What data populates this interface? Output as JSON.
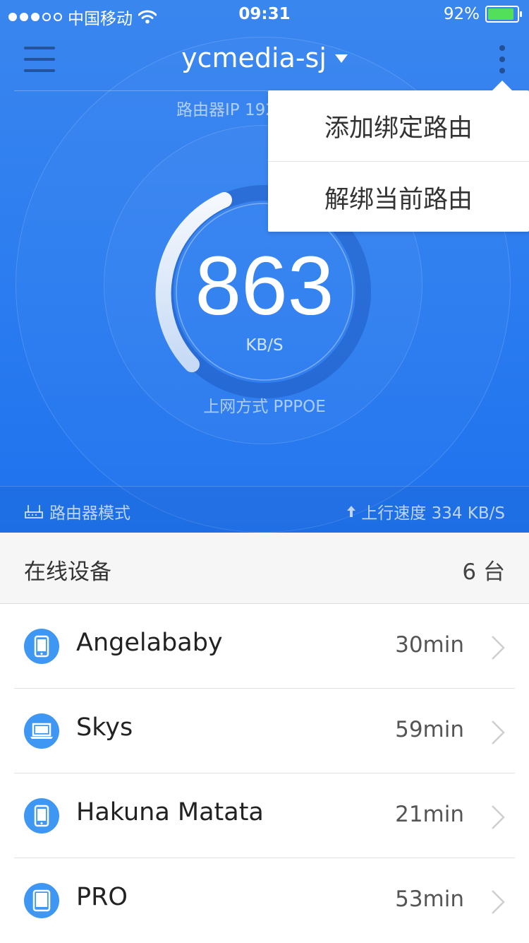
{
  "status_bar": {
    "carrier": "中国移动",
    "time": "09:31",
    "battery": "92%",
    "battery_level": 0.92
  },
  "nav": {
    "title": "ycmedia-sj"
  },
  "router": {
    "ip_label": "路由器IP 192",
    "speed_value": "863",
    "speed_unit": "KB/S",
    "connection_type": "上网方式 PPPOE",
    "mode": "路由器模式",
    "upload_speed": "上行速度 334 KB/S"
  },
  "dropdown": {
    "items": [
      {
        "label": "添加绑定路由"
      },
      {
        "label": "解绑当前路由"
      }
    ]
  },
  "devices": {
    "title": "在线设备",
    "count": "6 台",
    "items": [
      {
        "name": "Angelababy",
        "time": "30min",
        "icon": "phone-icon"
      },
      {
        "name": "Skys",
        "time": "59min",
        "icon": "laptop-icon"
      },
      {
        "name": "Hakuna Matata",
        "time": "21min",
        "icon": "phone-icon"
      },
      {
        "name": "PRO",
        "time": "53min",
        "icon": "tablet-icon"
      }
    ]
  },
  "colors": {
    "primary": "#2b7cf0",
    "device_icon": "#3f97f4",
    "battery": "#52e05a"
  }
}
